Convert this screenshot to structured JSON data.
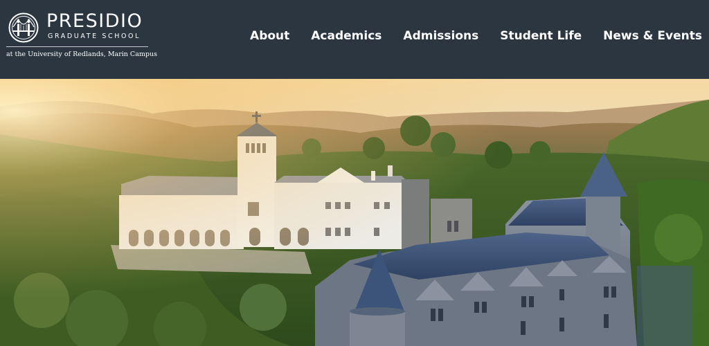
{
  "brand": {
    "name": "PRESIDIO",
    "subtitle": "GRADUATE SCHOOL",
    "tagline": "at the University of Redlands, Marin Campus",
    "seal_icon": "golden-gate-bridge-seal-icon"
  },
  "nav": {
    "items": [
      {
        "label": "About"
      },
      {
        "label": "Academics"
      },
      {
        "label": "Admissions"
      },
      {
        "label": "Student Life"
      },
      {
        "label": "News & Events"
      }
    ]
  },
  "colors": {
    "header_bg": "#2b3640",
    "nav_text": "#ffffff"
  },
  "hero": {
    "scene": "aerial-campus-photo"
  }
}
